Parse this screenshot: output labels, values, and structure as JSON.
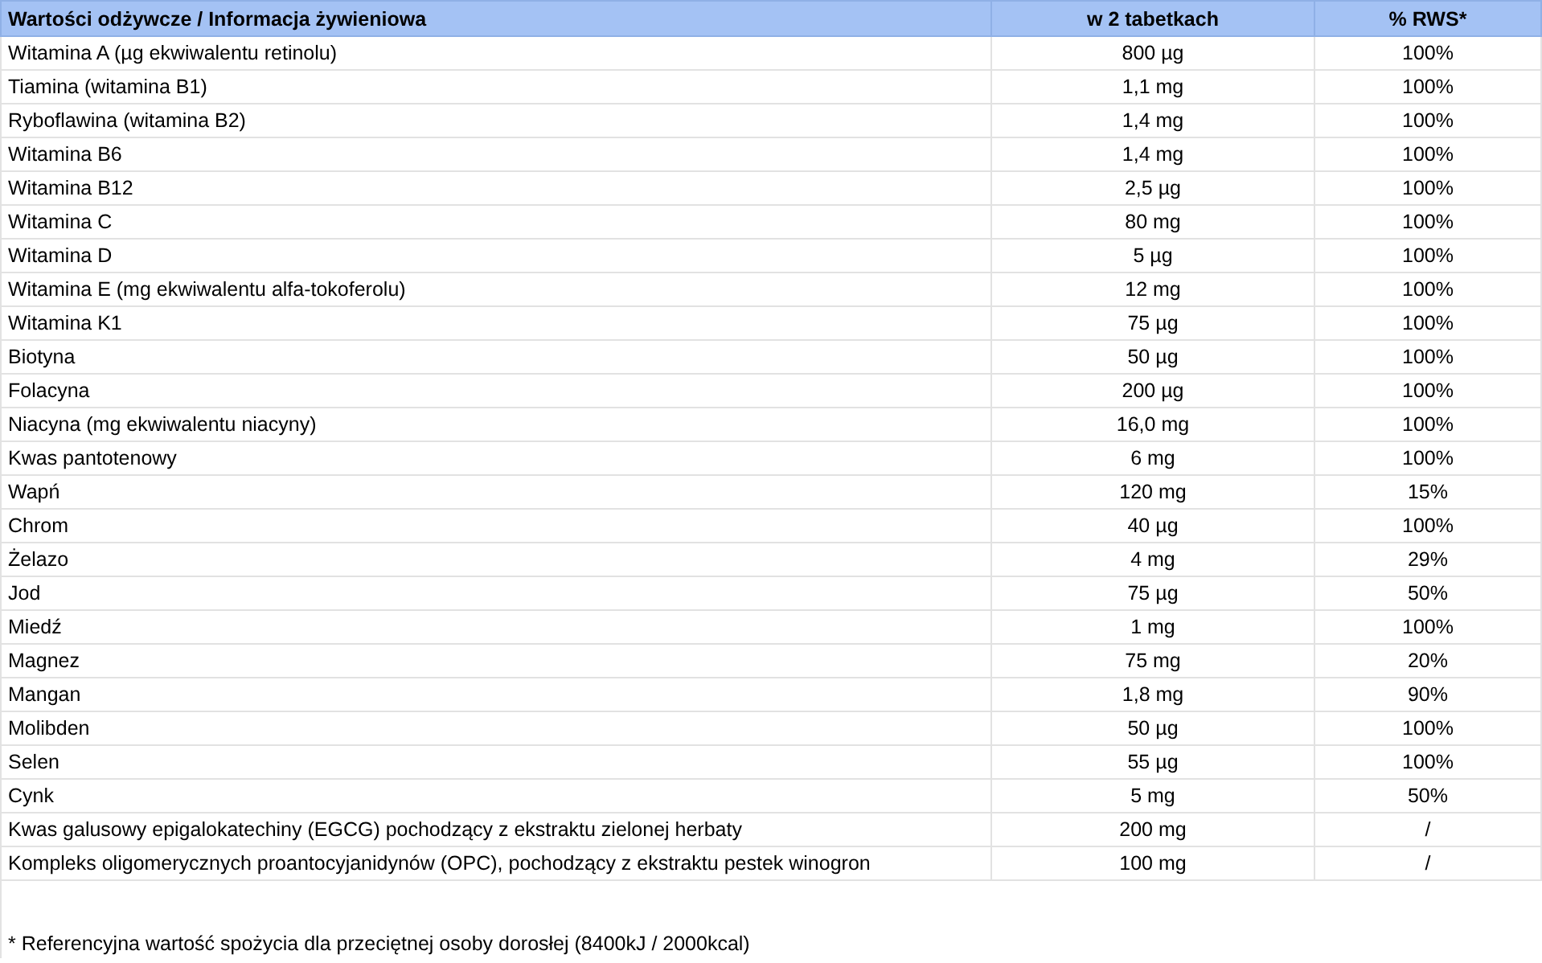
{
  "table": {
    "columns": [
      "Wartości odżywcze / Informacja żywieniowa",
      "w 2 tabetkach",
      "% RWS*"
    ],
    "rows": [
      [
        "Witamina A (µg ekwiwalentu retinolu)",
        "800 µg",
        "100%"
      ],
      [
        "Tiamina (witamina B1)",
        "1,1 mg",
        "100%"
      ],
      [
        "Ryboflawina (witamina B2)",
        "1,4 mg",
        "100%"
      ],
      [
        "Witamina B6",
        "1,4 mg",
        "100%"
      ],
      [
        "Witamina B12",
        "2,5 µg",
        "100%"
      ],
      [
        "Witamina C",
        "80 mg",
        "100%"
      ],
      [
        "Witamina D",
        "5 µg",
        "100%"
      ],
      [
        "Witamina E (mg ekwiwalentu alfa-tokoferolu)",
        "12 mg",
        "100%"
      ],
      [
        "Witamina K1",
        "75 µg",
        "100%"
      ],
      [
        "Biotyna",
        "50 µg",
        "100%"
      ],
      [
        "Folacyna",
        "200 µg",
        "100%"
      ],
      [
        "Niacyna (mg ekwiwalentu niacyny)",
        "16,0 mg",
        "100%"
      ],
      [
        "Kwas pantotenowy",
        "6 mg",
        "100%"
      ],
      [
        "Wapń",
        "120 mg",
        "15%"
      ],
      [
        "Chrom",
        "40 µg",
        "100%"
      ],
      [
        "Żelazo",
        "4 mg",
        "29%"
      ],
      [
        "Jod",
        "75 µg",
        "50%"
      ],
      [
        "Miedź",
        "1 mg",
        "100%"
      ],
      [
        "Magnez",
        "75 mg",
        "20%"
      ],
      [
        "Mangan",
        "1,8 mg",
        "90%"
      ],
      [
        "Molibden",
        "50 µg",
        "100%"
      ],
      [
        "Selen",
        "55 µg",
        "100%"
      ],
      [
        "Cynk",
        "5 mg",
        "50%"
      ],
      [
        "Kwas galusowy epigalokatechiny (EGCG) pochodzący z ekstraktu zielonej herbaty",
        "200 mg",
        "/"
      ],
      [
        "Kompleks oligomerycznych proantocyjanidynów (OPC), pochodzący z ekstraktu pestek winogron",
        "100 mg",
        "/"
      ]
    ],
    "footnote": "* Referencyjna wartość spożycia dla przeciętnej osoby dorosłej (8400kJ / 2000kcal)"
  }
}
